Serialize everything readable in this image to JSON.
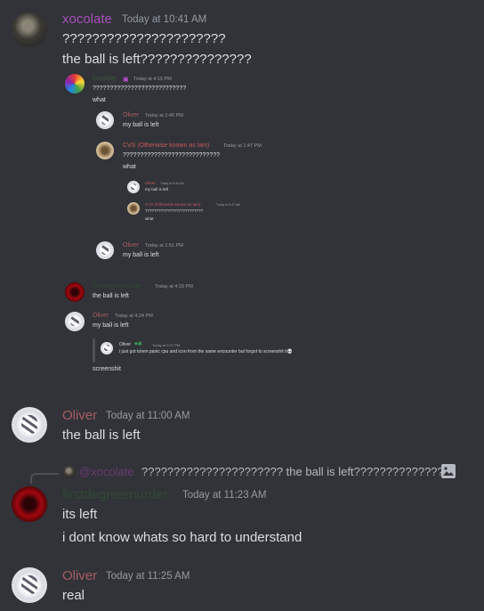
{
  "messages": {
    "m1": {
      "author": "xocolate",
      "timestamp": "Today at 10:41 AM",
      "lines": [
        "??????????????????????",
        "the ball is left???????????????"
      ],
      "colors": {
        "name": "#a652bb"
      }
    },
    "embedded": {
      "e1": {
        "author": "xocolate",
        "timestamp": "Today at 4:15 PM",
        "lines": [
          "???????????????????????????",
          "what"
        ]
      },
      "e2": {
        "author": "Oliver",
        "timestamp": "Today at 1:46 PM",
        "lines": [
          "my ball is left"
        ]
      },
      "e3": {
        "author": "CVS (Otherwise known as lam)",
        "timestamp": "Today at 1:47 PM",
        "lines": [
          "????????????????????????????",
          "what"
        ]
      },
      "e4": {
        "author": "Oliver",
        "timestamp": "Today at 5:46 AM",
        "lines": [
          "my ball is left"
        ]
      },
      "e5": {
        "author": "CVS (Otherwise known as lam)",
        "timestamp": "Today at 5:47 AM",
        "lines": [
          "??????????????????????????",
          "what"
        ]
      },
      "e6": {
        "author": "Oliver",
        "timestamp": "Today at 1:51 PM",
        "lines": [
          "my ball is left"
        ]
      },
      "e7": {
        "author": "firstdegreemurder",
        "timestamp": "Today at 4:15 PM",
        "lines": [
          "the ball is left"
        ]
      },
      "e8": {
        "author": "Oliver",
        "timestamp": "Today at 4:24 PM",
        "lines": [
          "my ball is left"
        ]
      },
      "e9": {
        "author": "Oliver",
        "timestamp": "Today at 5:27 PM",
        "lines": [
          "i just got totem panic cpu and icon from the same encounter but forgot to screenshit it💀"
        ]
      },
      "e10": {
        "lines": [
          "screenshit"
        ]
      }
    },
    "m2": {
      "author": "Oliver",
      "timestamp": "Today at 11:00 AM",
      "lines": [
        "the ball is left"
      ]
    },
    "m3": {
      "reply": {
        "author": "@xocolate",
        "text": "?????????????????????? the ball is left???????????????"
      },
      "author": "firstdegreemurder",
      "timestamp": "Today at 11:23 AM",
      "lines": [
        "its left",
        "i dont know whats so hard to understand"
      ]
    },
    "m4": {
      "author": "Oliver",
      "timestamp": "Today at 11:25 AM",
      "lines": [
        "real"
      ]
    }
  },
  "colors": {
    "background": "#313338",
    "text": "#dbdee1",
    "timestamp": "#949ba4",
    "xocolate": "#a652bb",
    "oliver": "#a75c62",
    "firstdegreemurder": "#2f4a31"
  },
  "icons": [
    "image-icon",
    "skull-emoji",
    "badge-icon"
  ]
}
